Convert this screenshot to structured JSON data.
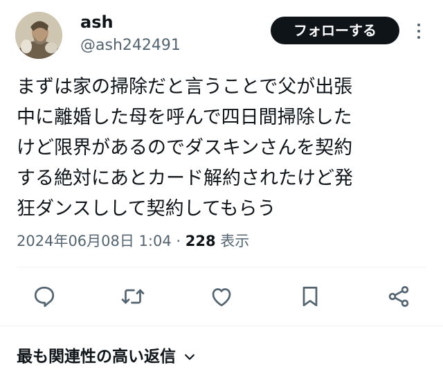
{
  "user": {
    "display_name": "ash",
    "handle": "@ash242491",
    "avatar_icon": "avatar-classical-painting"
  },
  "header": {
    "follow_label": "フォローする",
    "more_icon": "more-vertical-icon"
  },
  "tweet": {
    "text": "まずは家の掃除だと言うことで父が出張\n中に離婚した母を呼んで四日間掃除した\nけど限界があるのでダスキンさんを契約\nする絶対にあとカード解約されたけど発\n狂ダンスしして契約してもらう"
  },
  "meta": {
    "timestamp": "2024年06月08日 1:04",
    "separator": " · ",
    "views_count": "228",
    "views_label": "表示"
  },
  "actions": [
    {
      "name": "reply",
      "icon": "reply-icon"
    },
    {
      "name": "retweet",
      "icon": "retweet-icon"
    },
    {
      "name": "like",
      "icon": "heart-icon"
    },
    {
      "name": "bookmark",
      "icon": "bookmark-icon"
    },
    {
      "name": "share",
      "icon": "share-icon"
    }
  ],
  "replies": {
    "sort_label": "最も関連性の高い返信"
  },
  "colors": {
    "text": "#0f1419",
    "secondary": "#536471",
    "divider": "#eff3f4",
    "button_bg": "#0f1419"
  }
}
